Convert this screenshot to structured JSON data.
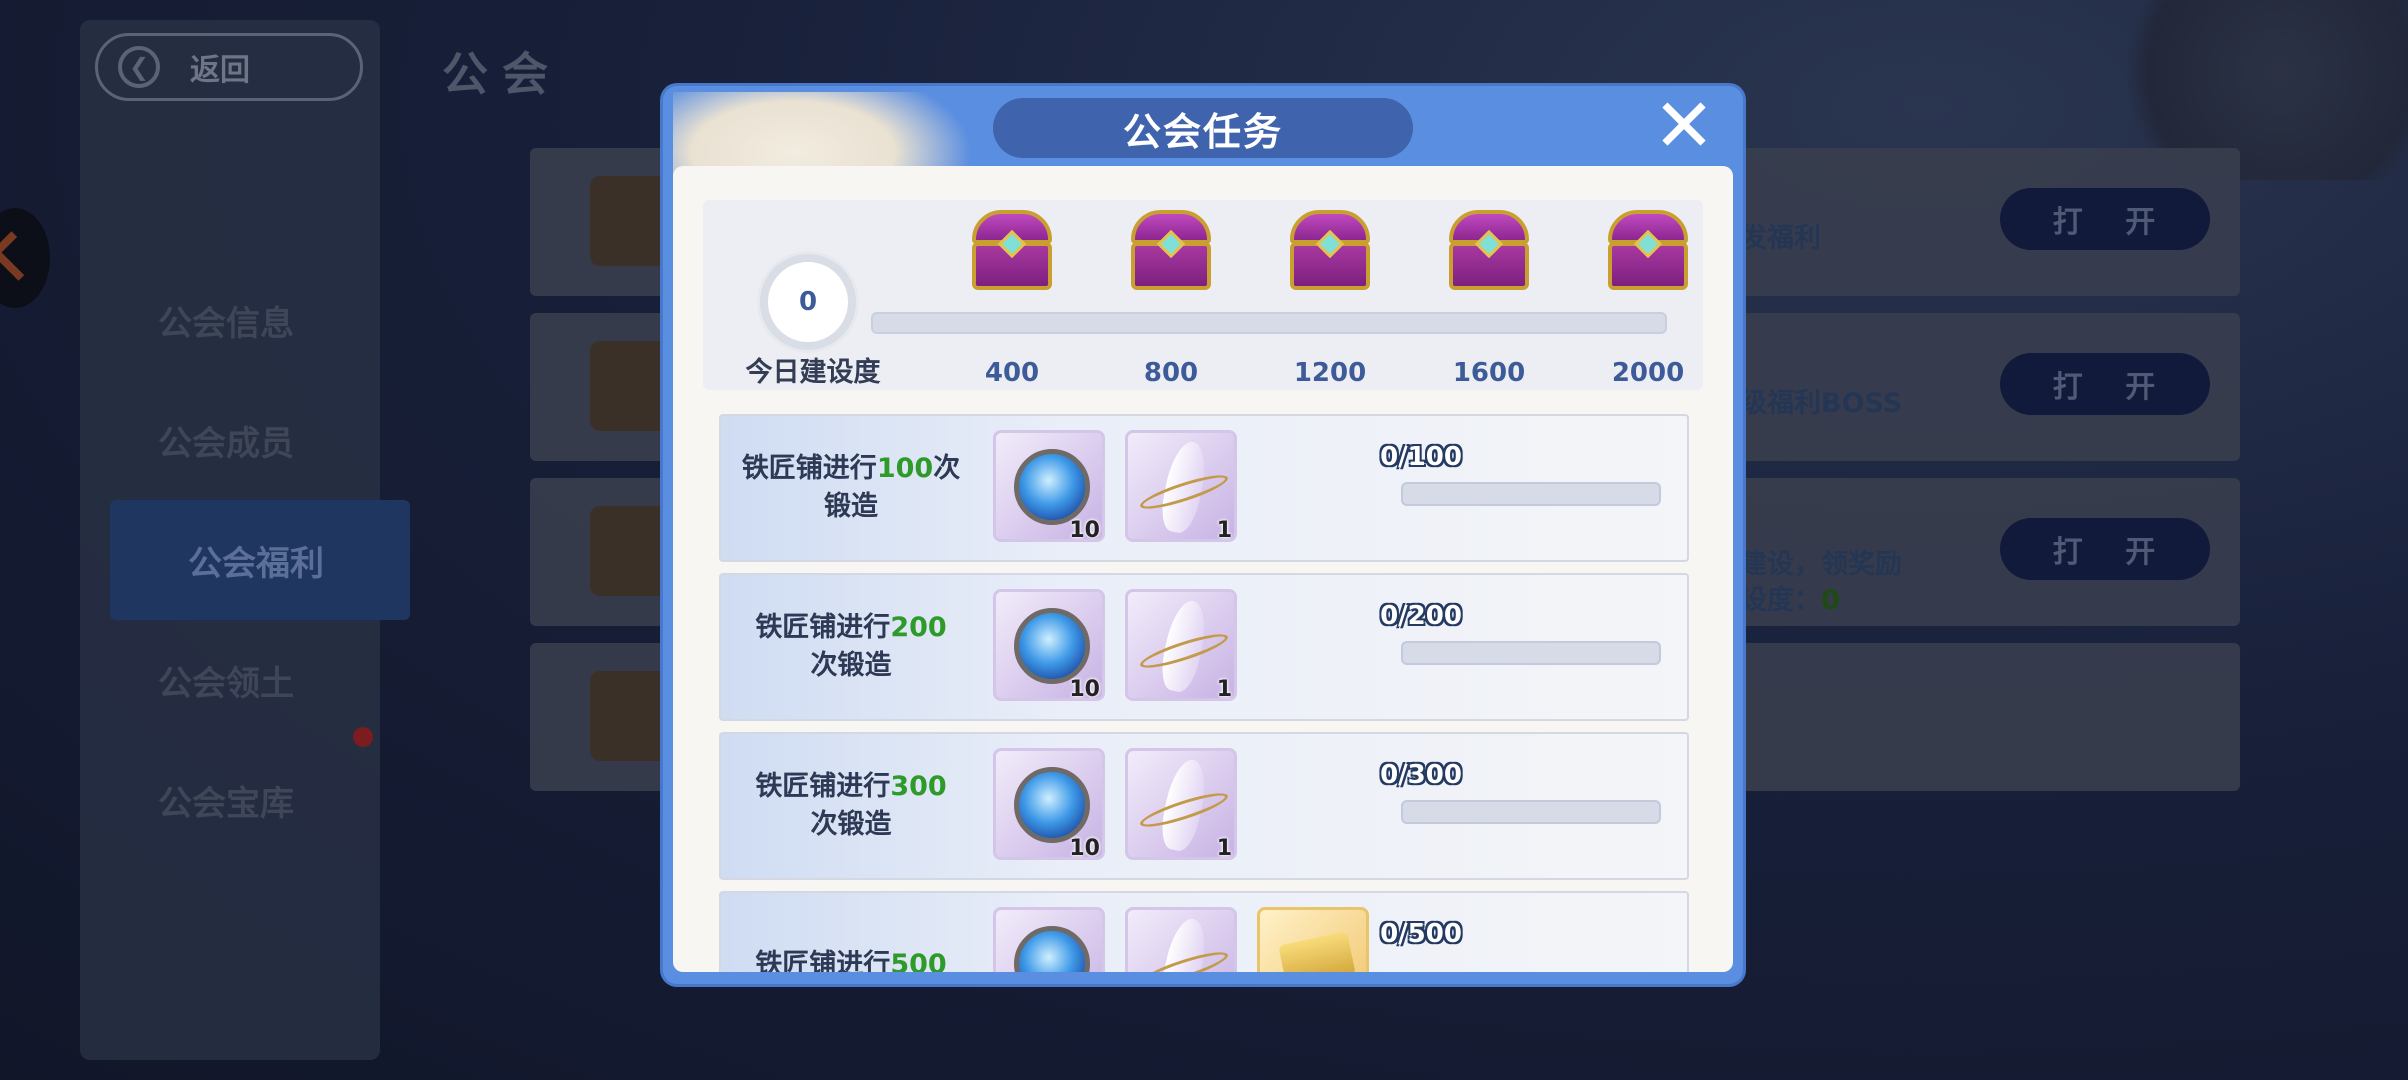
{
  "background": {
    "back_label": "返回",
    "page_title": "公会",
    "menu": [
      "公会信息",
      "公会成员",
      "公会福利",
      "公会领土",
      "公会宝库"
    ],
    "active_menu_index": 2,
    "cards": [
      {
        "text": "发福利",
        "open_label": "打 开"
      },
      {
        "text": "级福利BOSS",
        "open_label": "打 开"
      },
      {
        "text_line1": "建设，领奖励",
        "text_line2_prefix": "设度：",
        "text_line2_value": "0",
        "open_label": "打 开"
      }
    ]
  },
  "modal": {
    "title": "公会任务",
    "close_glyph": "✕",
    "today_value": "0",
    "today_label": "今日建设度",
    "progress_fraction": 0,
    "milestones": [
      "400",
      "800",
      "1200",
      "1600",
      "2000"
    ],
    "tasks": [
      {
        "pre": "铁匠铺进行",
        "num": "100",
        "post": "次",
        "line2": "锻造",
        "progress": "0/100",
        "fraction": 0,
        "rewards": [
          {
            "icon": "water-orb-icon",
            "qty": "10"
          },
          {
            "icon": "crystal-shard-icon",
            "qty": "1"
          }
        ]
      },
      {
        "pre": "铁匠铺进行",
        "num": "200",
        "post": "",
        "line2": "次锻造",
        "progress": "0/200",
        "fraction": 0,
        "rewards": [
          {
            "icon": "water-orb-icon",
            "qty": "10"
          },
          {
            "icon": "crystal-shard-icon",
            "qty": "1"
          }
        ]
      },
      {
        "pre": "铁匠铺进行",
        "num": "300",
        "post": "",
        "line2": "次锻造",
        "progress": "0/300",
        "fraction": 0,
        "rewards": [
          {
            "icon": "water-orb-icon",
            "qty": "10"
          },
          {
            "icon": "crystal-shard-icon",
            "qty": "1"
          }
        ]
      },
      {
        "pre": "铁匠铺进行",
        "num": "500",
        "post": "",
        "line2": "",
        "progress": "0/500",
        "fraction": 0,
        "rewards": [
          {
            "icon": "water-orb-icon",
            "qty": ""
          },
          {
            "icon": "crystal-shard-icon",
            "qty": ""
          },
          {
            "icon": "gold-ingot-icon",
            "qty": ""
          }
        ]
      }
    ]
  }
}
